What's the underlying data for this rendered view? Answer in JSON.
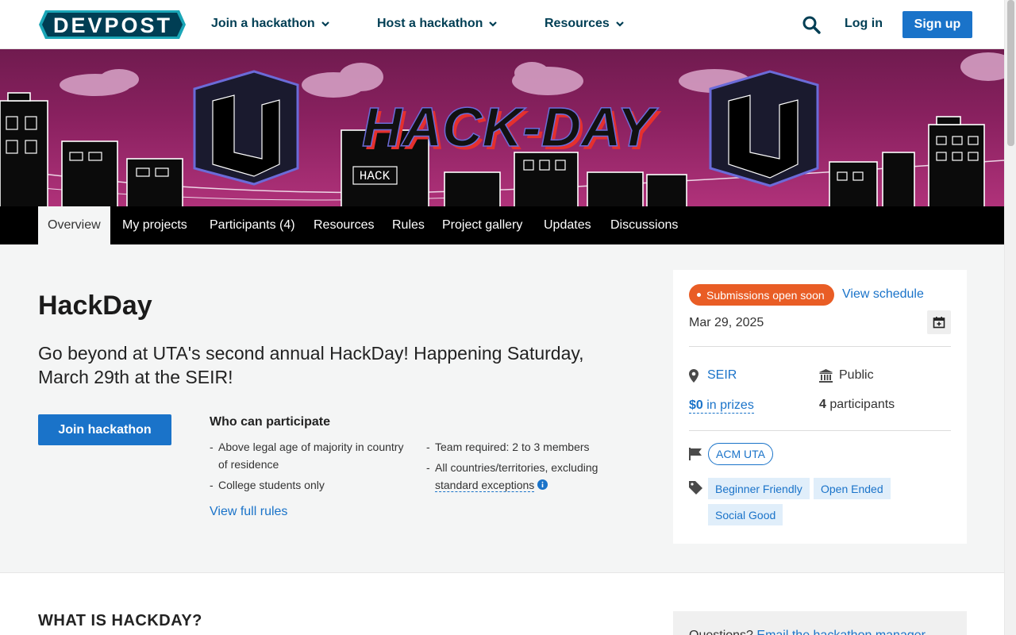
{
  "brand": {
    "logo_text": "DEVPOST",
    "primary_color": "#003e54",
    "accent_color": "#1a73c9"
  },
  "topnav": {
    "items": [
      {
        "label": "Join a hackathon"
      },
      {
        "label": "Host a hackathon"
      },
      {
        "label": "Resources"
      }
    ],
    "login_label": "Log in",
    "signup_label": "Sign up"
  },
  "banner": {
    "title_art": "HACK-DAY",
    "hack_sign": "HACK"
  },
  "tabs": [
    {
      "label": "Overview",
      "active": true
    },
    {
      "label": "My projects"
    },
    {
      "label": "Participants (4)"
    },
    {
      "label": "Resources"
    },
    {
      "label": "Rules"
    },
    {
      "label": "Project gallery"
    },
    {
      "label": "Updates"
    },
    {
      "label": "Discussions"
    }
  ],
  "hackathon": {
    "title": "HackDay",
    "tagline": "Go beyond at UTA's second annual HackDay! Happening Saturday, March 29th at the SEIR!",
    "join_label": "Join hackathon",
    "who_title": "Who can participate",
    "eligibility": [
      "Above legal age of majority in country of residence",
      "College students only",
      "Team required: 2 to 3 members",
      "All countries/territories, excluding"
    ],
    "standard_exceptions": "standard exceptions",
    "view_rules": "View full rules"
  },
  "sidecard": {
    "status": "Submissions open soon",
    "status_color": "#e95d25",
    "view_schedule": "View schedule",
    "date": "Mar 29, 2025",
    "location": "SEIR",
    "visibility": "Public",
    "prize_amount": "$0",
    "prize_suffix": "in prizes",
    "participant_count": "4",
    "participant_label": "participants",
    "host": "ACM UTA",
    "themes": [
      "Beginner Friendly",
      "Open Ended",
      "Social Good"
    ]
  },
  "lower": {
    "heading": "WHAT IS HACKDAY?",
    "questions_prefix": "Questions?",
    "questions_link": "Email the hackathon manager"
  }
}
